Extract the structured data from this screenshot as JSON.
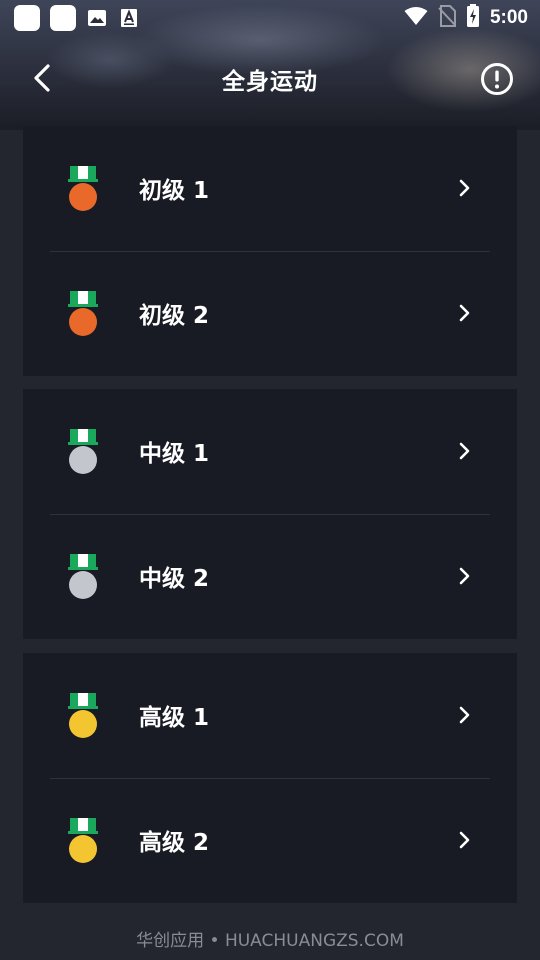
{
  "status_bar": {
    "time": "5:00"
  },
  "nav": {
    "title": "全身运动"
  },
  "groups": [
    {
      "medal_color": "#e8692a",
      "items": [
        {
          "label": "初级 1"
        },
        {
          "label": "初级 2"
        }
      ]
    },
    {
      "medal_color": "#c3c6cc",
      "items": [
        {
          "label": "中级 1"
        },
        {
          "label": "中级 2"
        }
      ]
    },
    {
      "medal_color": "#f3c531",
      "items": [
        {
          "label": "高级 1"
        },
        {
          "label": "高级 2"
        }
      ]
    }
  ],
  "ribbon_colors": {
    "green": "#1aa85c",
    "white": "#ffffff"
  },
  "footer": {
    "text": "华创应用 • HUACHUANGZS.COM"
  }
}
